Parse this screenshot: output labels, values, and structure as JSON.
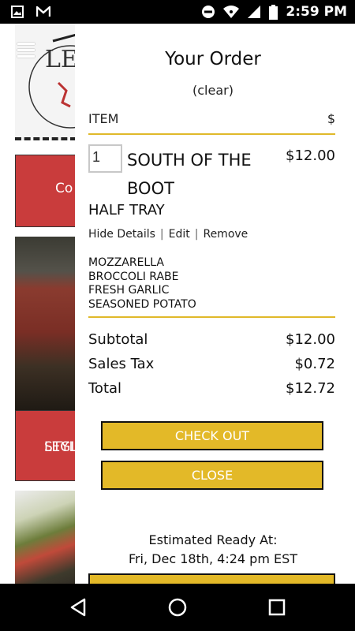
{
  "status_bar": {
    "time": "2:59 PM",
    "icons": [
      "image-icon",
      "gmail-icon",
      "do-not-disturb-icon",
      "wifi-icon",
      "signal-icon",
      "battery-icon"
    ]
  },
  "background": {
    "tile1_text": "Co",
    "tile2_line1": "LEGIO",
    "tile2_line2": "STYL"
  },
  "order": {
    "title": "Your Order",
    "clear_label": "(clear)",
    "header_item": "ITEM",
    "header_price": "$",
    "item": {
      "quantity": "1",
      "name": "SOUTH OF THE BOOT",
      "price": "$12.00",
      "size": "HALF TRAY",
      "hide_details": "Hide Details",
      "edit": "Edit",
      "remove": "Remove",
      "separator": "|",
      "toppings": [
        "MOZZARELLA",
        "BROCCOLI RABE",
        "FRESH GARLIC",
        "SEASONED POTATO"
      ]
    },
    "subtotal_label": "Subtotal",
    "subtotal_value": "$12.00",
    "tax_label": "Sales Tax",
    "tax_value": "$0.72",
    "total_label": "Total",
    "total_value": "$12.72",
    "checkout_label": "CHECK OUT",
    "close_label": "CLOSE",
    "estimated_label": "Estimated Ready At:",
    "estimated_time": "Fri, Dec 18th, 4:24 pm EST"
  },
  "colors": {
    "accent_yellow": "#e3b928",
    "brand_red": "#c93c3c"
  }
}
